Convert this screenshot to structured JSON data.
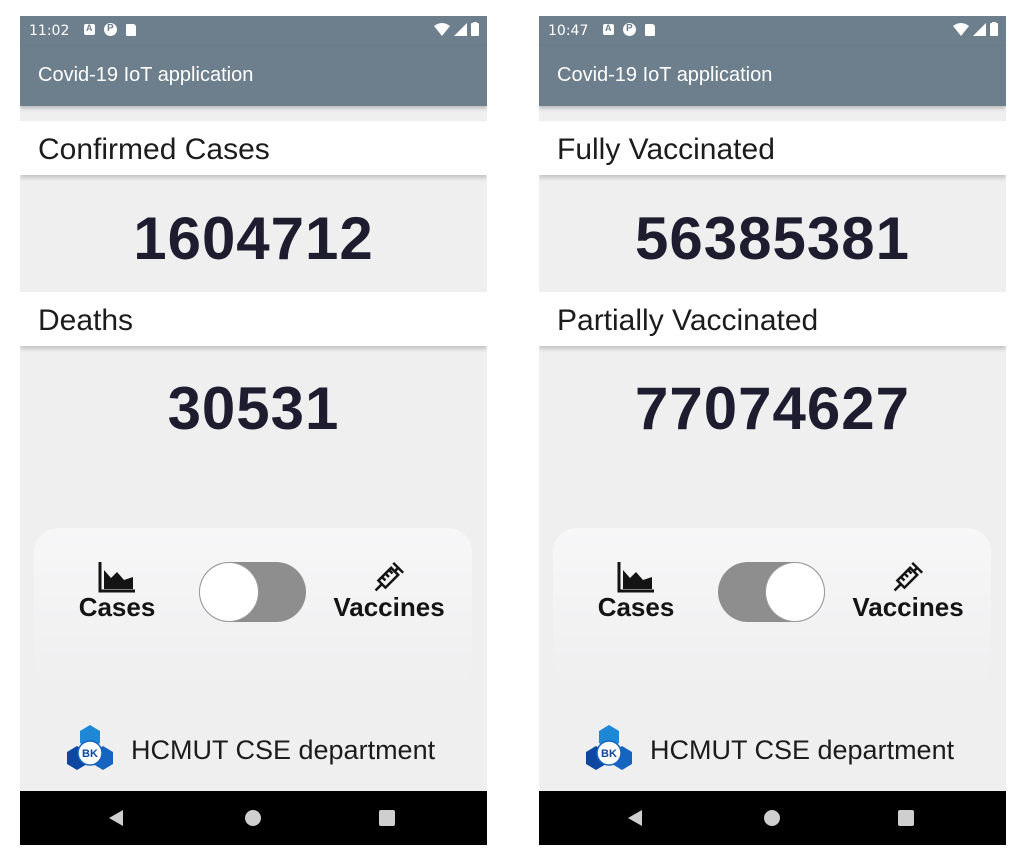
{
  "colors": {
    "app_bar": "#6d7f8c",
    "background": "#efeff0",
    "value_text": "#1d1d2f",
    "toggle_track": "#8e8e8e",
    "nav_bar": "#000000"
  },
  "screens": [
    {
      "status": {
        "time": "11:02"
      },
      "app_title": "Covid-19 IoT application",
      "stats": [
        {
          "label": "Confirmed Cases",
          "value": "1604712"
        },
        {
          "label": "Deaths",
          "value": "30531"
        }
      ],
      "switch": {
        "left_label": "Cases",
        "left_icon": "area-chart-icon",
        "right_label": "Vaccines",
        "right_icon": "syringe-icon",
        "selected": "Cases"
      },
      "footer": {
        "logo_text": "BK",
        "text": "HCMUT CSE department"
      }
    },
    {
      "status": {
        "time": "10:47"
      },
      "app_title": "Covid-19 IoT application",
      "stats": [
        {
          "label": "Fully Vaccinated",
          "value": "56385381"
        },
        {
          "label": "Partially Vaccinated",
          "value": "77074627"
        }
      ],
      "switch": {
        "left_label": "Cases",
        "left_icon": "area-chart-icon",
        "right_label": "Vaccines",
        "right_icon": "syringe-icon",
        "selected": "Vaccines"
      },
      "footer": {
        "logo_text": "BK",
        "text": "HCMUT CSE department"
      }
    }
  ]
}
